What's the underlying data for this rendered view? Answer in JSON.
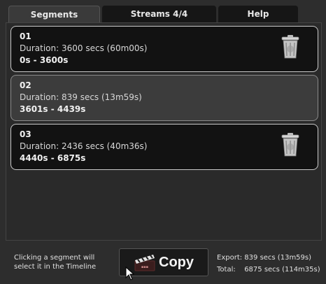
{
  "tabs": [
    {
      "label": "Segments",
      "active": true
    },
    {
      "label": "Streams 4/4",
      "active": false
    },
    {
      "label": "Help",
      "active": false
    }
  ],
  "segments": [
    {
      "number": "01",
      "duration": "Duration: 3600 secs (60m00s)",
      "range": "0s - 3600s",
      "selected": false,
      "has_delete": true
    },
    {
      "number": "02",
      "duration": "Duration: 839 secs (13m59s)",
      "range": "3601s - 4439s",
      "selected": true,
      "has_delete": false
    },
    {
      "number": "03",
      "duration": "Duration: 2436 secs (40m36s)",
      "range": "4440s - 6875s",
      "selected": false,
      "has_delete": true
    }
  ],
  "footer": {
    "note": "Clicking a segment will select it in the Timeline",
    "copy_label": "Copy",
    "copy_icon": "clapperboard-icon",
    "export_label": "Export:",
    "export_value": "839 secs (13m59s)",
    "total_label": "Total:",
    "total_value": "6875 secs (114m35s)"
  },
  "colors": {
    "background": "#2d2d2d",
    "segment_bg": "#121212",
    "segment_selected_bg": "#3c3c3c",
    "segment_border": "#c9c9c9"
  }
}
